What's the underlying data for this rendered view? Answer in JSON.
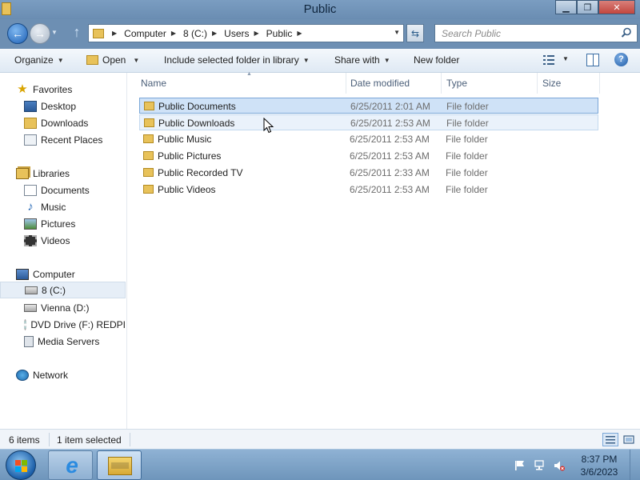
{
  "window": {
    "title": "Public",
    "minimize_icon": "minimize-icon",
    "maximize_icon": "maximize-icon",
    "close_icon": "close-icon"
  },
  "address": {
    "crumbs": [
      "Computer",
      "8 (C:)",
      "Users",
      "Public"
    ],
    "search_placeholder": "Search Public"
  },
  "toolbar": {
    "organize": "Organize",
    "open": "Open",
    "include": "Include selected folder in library",
    "share": "Share with",
    "new_folder": "New folder"
  },
  "nav": {
    "favorites": {
      "header": "Favorites",
      "items": [
        "Desktop",
        "Downloads",
        "Recent Places"
      ]
    },
    "libraries": {
      "header": "Libraries",
      "items": [
        "Documents",
        "Music",
        "Pictures",
        "Videos"
      ]
    },
    "computer": {
      "header": "Computer",
      "items": [
        "8 (C:)",
        "Vienna (D:)",
        "DVD Drive (F:) REDPI",
        "Media Servers"
      ]
    },
    "network": {
      "header": "Network"
    }
  },
  "columns": {
    "name": "Name",
    "date": "Date modified",
    "type": "Type",
    "size": "Size"
  },
  "files": [
    {
      "name": "Public Documents",
      "date": "6/25/2011 2:01 AM",
      "type": "File folder",
      "size": "",
      "state": "selected"
    },
    {
      "name": "Public Downloads",
      "date": "6/25/2011 2:53 AM",
      "type": "File folder",
      "size": "",
      "state": "hover"
    },
    {
      "name": "Public Music",
      "date": "6/25/2011 2:53 AM",
      "type": "File folder",
      "size": "",
      "state": "normal"
    },
    {
      "name": "Public Pictures",
      "date": "6/25/2011 2:53 AM",
      "type": "File folder",
      "size": "",
      "state": "normal"
    },
    {
      "name": "Public Recorded TV",
      "date": "6/25/2011 2:33 AM",
      "type": "File folder",
      "size": "",
      "state": "normal"
    },
    {
      "name": "Public Videos",
      "date": "6/25/2011 2:53 AM",
      "type": "File folder",
      "size": "",
      "state": "normal"
    }
  ],
  "status": {
    "count": "6 items",
    "selection": "1 item selected"
  },
  "taskbar": {
    "time": "8:37 PM",
    "date": "3/6/2023"
  },
  "colors": {
    "selection_bg": "#cfe2f7",
    "selection_border": "#7aa7d8",
    "folder": "#e8c25a",
    "taskbar": "#7ea3c8"
  }
}
